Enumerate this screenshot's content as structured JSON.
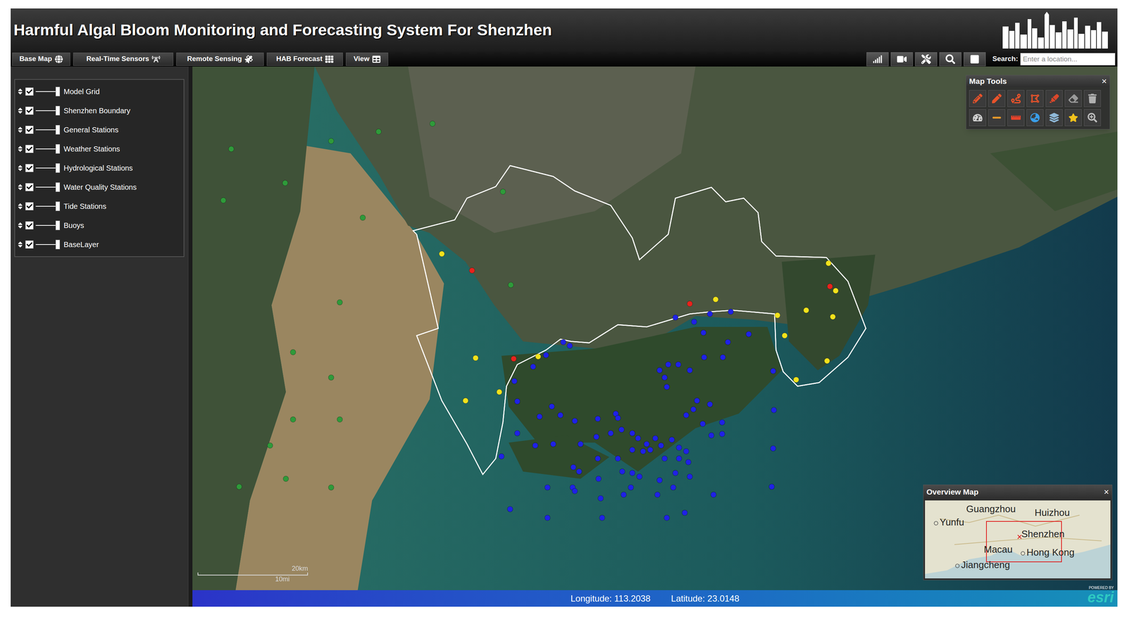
{
  "window": {
    "title": "Harmful Algal Bloom Monitoring and Forecasting System For Shenzhen"
  },
  "menu": [
    {
      "label": "Base Map"
    },
    {
      "label": "Real-Time Sensors"
    },
    {
      "label": "Remote Sensing"
    },
    {
      "label": "HAB Forecast"
    },
    {
      "label": "View"
    }
  ],
  "search": {
    "label": "Search:",
    "placeholder": "Enter a location..."
  },
  "layers": [
    {
      "label": "Model Grid",
      "checked": true,
      "level": 1
    },
    {
      "label": "Shenzhen Boundary",
      "checked": true,
      "level": 1
    },
    {
      "label": "General Stations",
      "checked": true,
      "level": 1
    },
    {
      "label": "Weather Stations",
      "checked": true,
      "level": 1
    },
    {
      "label": "Hydrological Stations",
      "checked": true,
      "level": 1
    },
    {
      "label": "Water Quality Stations",
      "checked": true,
      "level": 1
    },
    {
      "label": "Tide Stations",
      "checked": true,
      "level": 1
    },
    {
      "label": "Buoys",
      "checked": true,
      "level": 1
    },
    {
      "label": "BaseLayer",
      "checked": true,
      "level": 1
    }
  ],
  "map_tools": {
    "title": "Map Tools",
    "close": "×"
  },
  "marker_groups": [
    {
      "color": "#2f9a3a"
    },
    {
      "color": "#f2e21c"
    },
    {
      "color": "#e8231d"
    },
    {
      "color": "#1f22e6"
    }
  ],
  "scale_bar": {
    "metric": "20km",
    "imperial": "10mi"
  },
  "overview_map": {
    "title": "Overview Map",
    "close": "×",
    "places": [
      "Guangzhou",
      "Huizhou",
      "Yunfu",
      "Shenzhen",
      "Macau",
      "Hong Kong",
      "Jiangcheng"
    ]
  },
  "attribution": {
    "powered_by": "POWERED BY",
    "logo": "esri"
  },
  "status_bar": {
    "longitude_label": "Longitude:",
    "longitude": "113.2038",
    "latitude_label": "Latitude:",
    "latitude": "23.0148"
  }
}
